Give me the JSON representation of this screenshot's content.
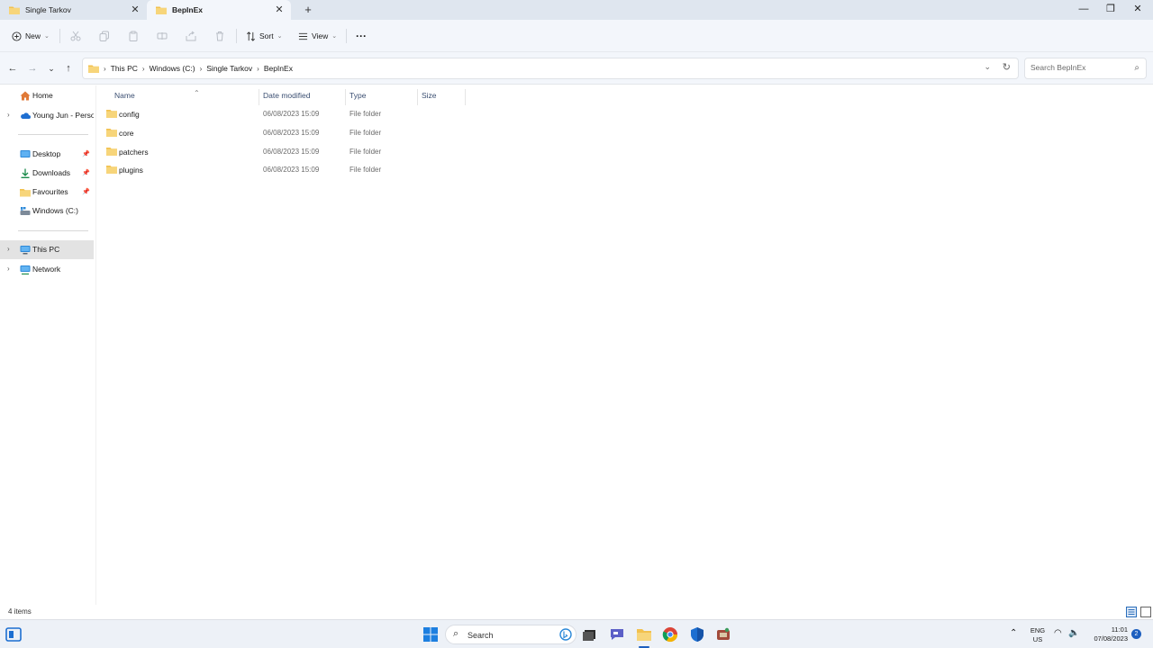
{
  "tabs": [
    {
      "label": "Single Tarkov"
    },
    {
      "label": "BepInEx"
    }
  ],
  "toolbar": {
    "new_label": "New",
    "sort_label": "Sort",
    "view_label": "View",
    "more_label": "···"
  },
  "address": {
    "crumbs": [
      "This PC",
      "Windows (C:)",
      "Single Tarkov",
      "BepInEx"
    ],
    "search_placeholder": "Search BepInEx"
  },
  "sidebar": {
    "items": [
      {
        "label": "Home"
      },
      {
        "label": "Young Jun - Personal"
      },
      {
        "label": "Desktop"
      },
      {
        "label": "Downloads"
      },
      {
        "label": "Favourites"
      },
      {
        "label": "Windows (C:)"
      },
      {
        "label": "This PC"
      },
      {
        "label": "Network"
      }
    ]
  },
  "columns": {
    "name": "Name",
    "date": "Date modified",
    "type": "Type",
    "size": "Size"
  },
  "files": [
    {
      "name": "config",
      "date": "06/08/2023 15:09",
      "type": "File folder"
    },
    {
      "name": "core",
      "date": "06/08/2023 15:09",
      "type": "File folder"
    },
    {
      "name": "patchers",
      "date": "06/08/2023 15:09",
      "type": "File folder"
    },
    {
      "name": "plugins",
      "date": "06/08/2023 15:09",
      "type": "File folder"
    }
  ],
  "status": {
    "item_count": "4 items"
  },
  "taskbar": {
    "search_label": "Search",
    "lang": "ENG",
    "region": "US",
    "time": "11:01",
    "date": "07/08/2023",
    "notification_count": "2"
  },
  "colors": {
    "folder": "#f2c14e",
    "accent": "#1d5fbf"
  }
}
